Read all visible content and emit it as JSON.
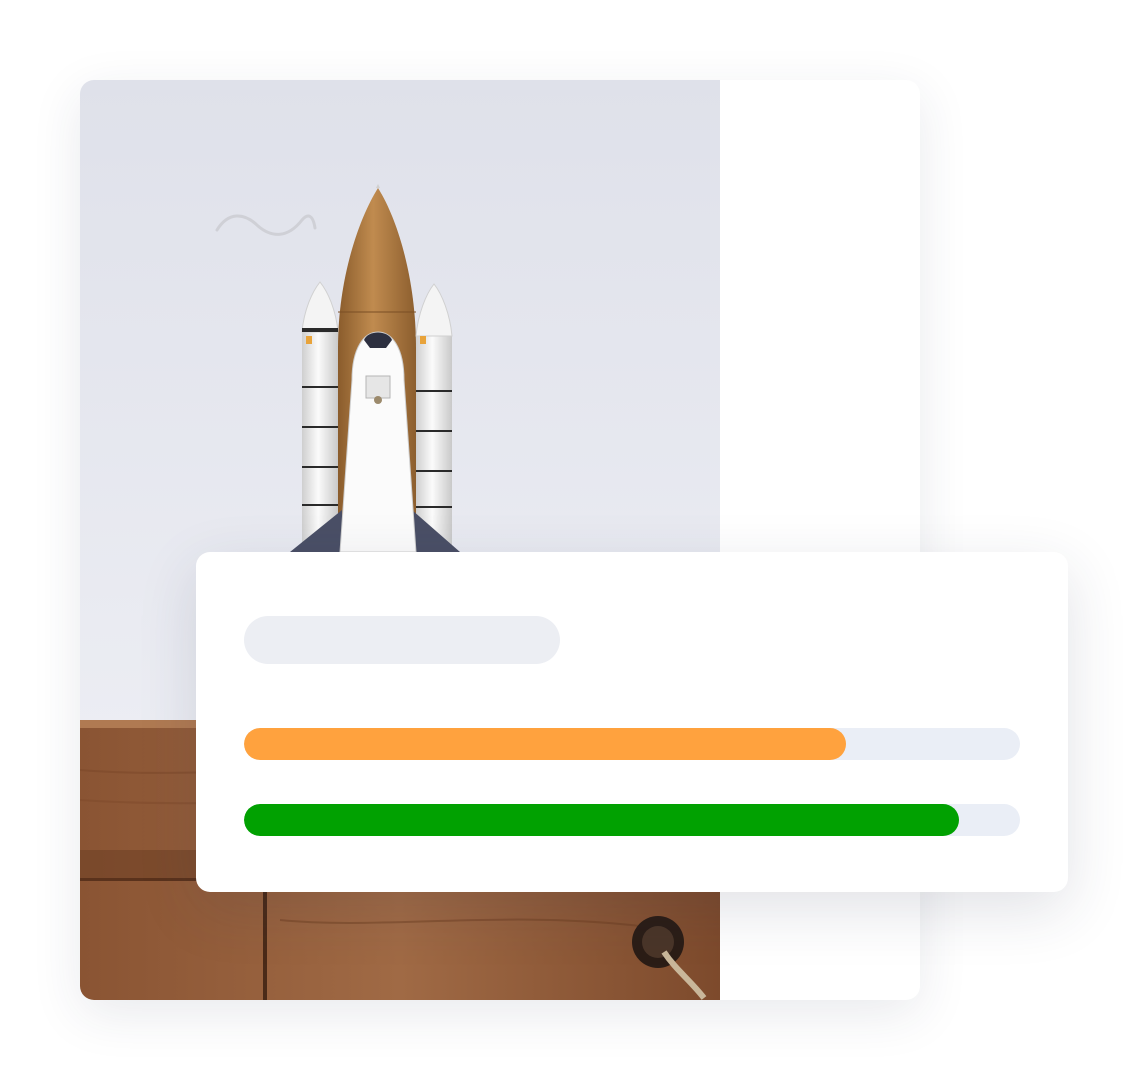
{
  "colors": {
    "progress_primary": "#ffa23e",
    "progress_secondary": "#01a101",
    "track": "#eaeef6",
    "placeholder": "#eceef3"
  },
  "icons": {
    "decoration": "wave-icon"
  },
  "progress": [
    {
      "value": 0.776
    },
    {
      "value": 0.921
    }
  ]
}
